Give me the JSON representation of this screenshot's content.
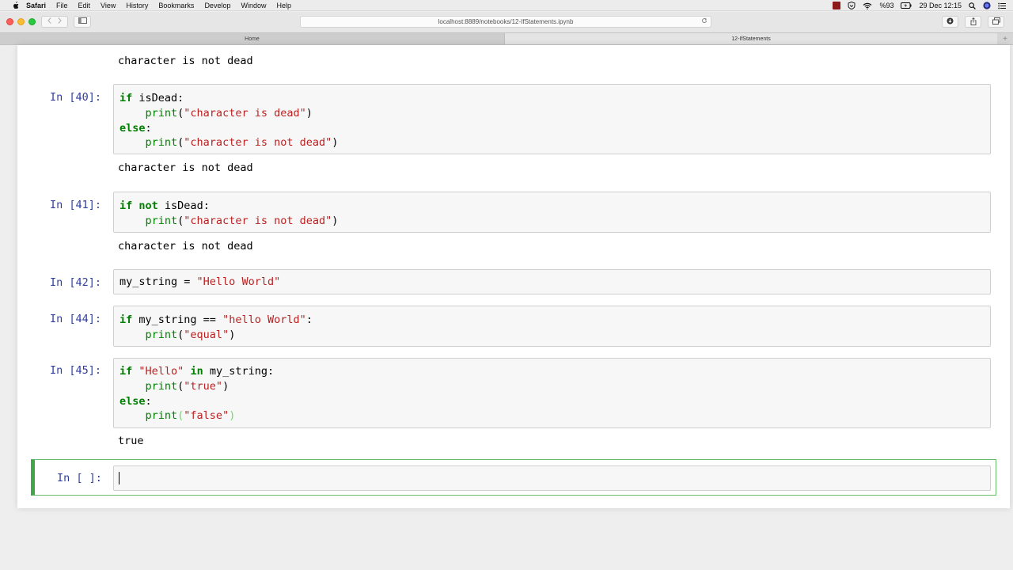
{
  "menubar": {
    "app": "Safari",
    "items": [
      "File",
      "Edit",
      "View",
      "History",
      "Bookmarks",
      "Develop",
      "Window",
      "Help"
    ],
    "battery": "%93",
    "datetime": "29 Dec  12:15"
  },
  "browser": {
    "url": "localhost:8889/notebooks/12-IfStatements.ipynb",
    "tabs": [
      "Home",
      "12-IfStatements"
    ],
    "new_tab": "+"
  },
  "notebook": {
    "output_top": "character is not dead",
    "cells": [
      {
        "prompt": "In [40]:",
        "lines": [
          [
            {
              "t": "if",
              "c": "kw"
            },
            {
              "t": " isDead:",
              "c": "plain"
            }
          ],
          [
            {
              "t": "    ",
              "c": "plain"
            },
            {
              "t": "print",
              "c": "fn"
            },
            {
              "t": "(",
              "c": "plain"
            },
            {
              "t": "\"character is dead\"",
              "c": "str"
            },
            {
              "t": ")",
              "c": "plain"
            }
          ],
          [
            {
              "t": "else",
              "c": "kw"
            },
            {
              "t": ":",
              "c": "plain"
            }
          ],
          [
            {
              "t": "    ",
              "c": "plain"
            },
            {
              "t": "print",
              "c": "fn"
            },
            {
              "t": "(",
              "c": "plain"
            },
            {
              "t": "\"character is not dead\"",
              "c": "str"
            },
            {
              "t": ")",
              "c": "plain"
            }
          ]
        ],
        "output": "character is not dead"
      },
      {
        "prompt": "In [41]:",
        "lines": [
          [
            {
              "t": "if",
              "c": "kw"
            },
            {
              "t": " ",
              "c": "plain"
            },
            {
              "t": "not",
              "c": "kw"
            },
            {
              "t": " isDead:",
              "c": "plain"
            }
          ],
          [
            {
              "t": "    ",
              "c": "plain"
            },
            {
              "t": "print",
              "c": "fn"
            },
            {
              "t": "(",
              "c": "plain"
            },
            {
              "t": "\"character is not dead\"",
              "c": "str"
            },
            {
              "t": ")",
              "c": "plain"
            }
          ]
        ],
        "output": "character is not dead"
      },
      {
        "prompt": "In [42]:",
        "lines": [
          [
            {
              "t": "my_string = ",
              "c": "plain"
            },
            {
              "t": "\"Hello World\"",
              "c": "str"
            }
          ]
        ],
        "output": null
      },
      {
        "prompt": "In [44]:",
        "lines": [
          [
            {
              "t": "if",
              "c": "kw"
            },
            {
              "t": " my_string == ",
              "c": "plain"
            },
            {
              "t": "\"hello World\"",
              "c": "str"
            },
            {
              "t": ":",
              "c": "plain"
            }
          ],
          [
            {
              "t": "    ",
              "c": "plain"
            },
            {
              "t": "print",
              "c": "fn"
            },
            {
              "t": "(",
              "c": "plain"
            },
            {
              "t": "\"equal\"",
              "c": "str"
            },
            {
              "t": ")",
              "c": "plain"
            }
          ]
        ],
        "output": null
      },
      {
        "prompt": "In [45]:",
        "lines": [
          [
            {
              "t": "if",
              "c": "kw"
            },
            {
              "t": " ",
              "c": "plain"
            },
            {
              "t": "\"Hello\"",
              "c": "str"
            },
            {
              "t": " ",
              "c": "plain"
            },
            {
              "t": "in",
              "c": "kw"
            },
            {
              "t": " my_string:",
              "c": "plain"
            }
          ],
          [
            {
              "t": "    ",
              "c": "plain"
            },
            {
              "t": "print",
              "c": "fn"
            },
            {
              "t": "(",
              "c": "plain"
            },
            {
              "t": "\"true\"",
              "c": "str"
            },
            {
              "t": ")",
              "c": "plain"
            }
          ],
          [
            {
              "t": "else",
              "c": "kw"
            },
            {
              "t": ":",
              "c": "plain"
            }
          ],
          [
            {
              "t": "    ",
              "c": "plain"
            },
            {
              "t": "print",
              "c": "fn"
            },
            {
              "t": "(",
              "c": "bracket-hl"
            },
            {
              "t": "\"false\"",
              "c": "str"
            },
            {
              "t": ")",
              "c": "bracket-hl"
            }
          ]
        ],
        "output": "true"
      }
    ],
    "empty_prompt": "In [ ]:"
  },
  "colors": {
    "prompt": "#303f9f",
    "keyword": "#008000",
    "string": "#ba2121",
    "selected_border": "#42a548"
  }
}
